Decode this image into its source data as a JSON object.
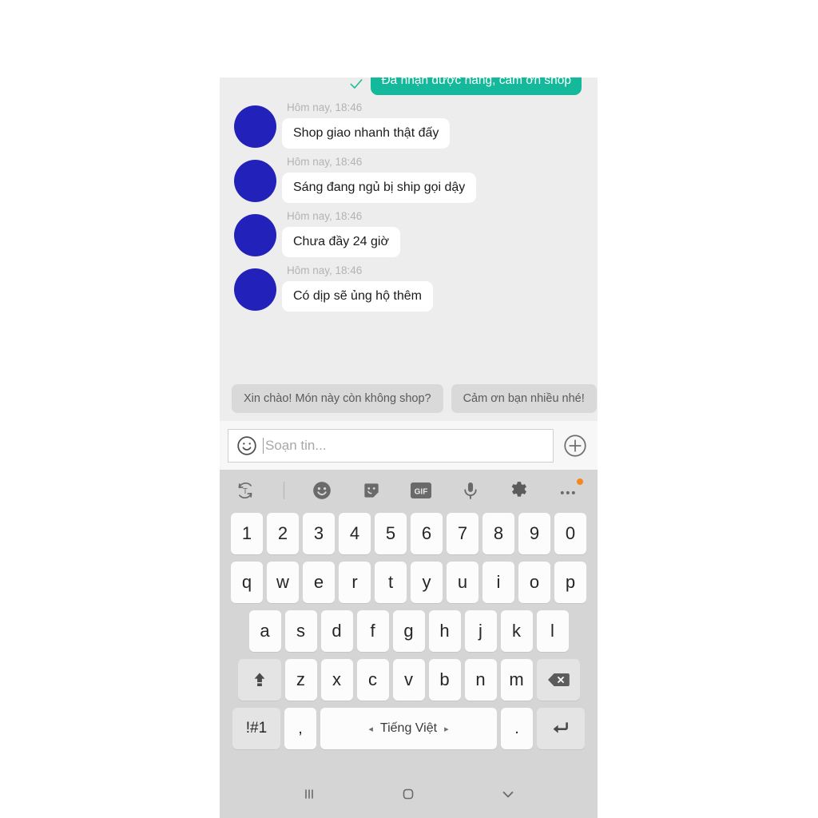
{
  "chat": {
    "outgoing_partial": {
      "text": "Đã nhận được hàng, cảm ơn shop",
      "status_icon": "check-icon",
      "bubble_color": "#14b89a"
    },
    "messages": [
      {
        "time": "Hôm nay, 18:46",
        "text": "Shop giao nhanh thật đấy"
      },
      {
        "time": "Hôm nay, 18:46",
        "text": "Sáng đang ngủ bị ship gọi dậy"
      },
      {
        "time": "Hôm nay, 18:46",
        "text": "Chưa đầy 24 giờ"
      },
      {
        "time": "Hôm nay, 18:46",
        "text": "Có dịp sẽ ủng hộ thêm"
      }
    ],
    "avatar_color": "#2222bb",
    "quick_replies": [
      "Xin chào! Món này còn không shop?",
      "Cảm ơn bạn nhiều nhé!"
    ]
  },
  "composer": {
    "emoji_icon": "smiley-face-icon",
    "placeholder": "Soạn tin...",
    "value": "",
    "attach_icon": "plus-circle-icon"
  },
  "keyboard": {
    "toolbar": [
      {
        "name": "translate-icon",
        "label": "T"
      },
      {
        "name": "toolbar-divider",
        "label": ""
      },
      {
        "name": "emoji-icon",
        "label": ""
      },
      {
        "name": "sticker-icon",
        "label": ""
      },
      {
        "name": "gif-icon",
        "label": "GIF"
      },
      {
        "name": "microphone-icon",
        "label": ""
      },
      {
        "name": "settings-gear-icon",
        "label": ""
      },
      {
        "name": "more-options-icon",
        "label": ""
      }
    ],
    "gif_label": "GIF",
    "row_numbers": [
      "1",
      "2",
      "3",
      "4",
      "5",
      "6",
      "7",
      "8",
      "9",
      "0"
    ],
    "row_top": [
      "q",
      "w",
      "e",
      "r",
      "t",
      "y",
      "u",
      "i",
      "o",
      "p"
    ],
    "row_home": [
      "a",
      "s",
      "d",
      "f",
      "g",
      "h",
      "j",
      "k",
      "l"
    ],
    "row_bottom": [
      "z",
      "x",
      "c",
      "v",
      "b",
      "n",
      "m"
    ],
    "shift_icon": "shift-arrow-icon",
    "backspace_icon": "backspace-icon",
    "symbols_label": "!#1",
    "comma_label": ",",
    "period_label": ".",
    "space_label": "Tiếng Việt",
    "space_prev_arrow": "◂",
    "space_next_arrow": "▸",
    "enter_icon": "enter-return-icon"
  },
  "navbar": {
    "recents_icon": "recents-icon",
    "home_icon": "home-icon",
    "dismiss_keyboard_icon": "chevron-down-icon"
  },
  "colors": {
    "outgoing_bubble": "#14b89a",
    "avatar": "#2222bb",
    "chat_background": "#ededed",
    "keyboard_background": "#d5d5d5",
    "badge": "#f7861b"
  }
}
